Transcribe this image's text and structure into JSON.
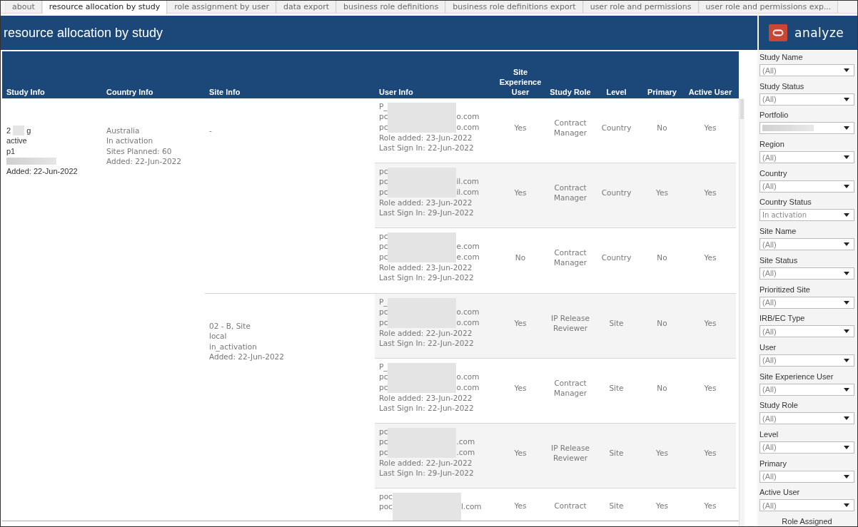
{
  "tabs": [
    {
      "label": "about",
      "selected": false
    },
    {
      "label": "resource allocation by study",
      "selected": true
    },
    {
      "label": "role assignment by user",
      "selected": false
    },
    {
      "label": "data export",
      "selected": false
    },
    {
      "label": "business role definitions",
      "selected": false
    },
    {
      "label": "business role definitions export",
      "selected": false
    },
    {
      "label": "user role and permissions",
      "selected": false
    },
    {
      "label": "user role and permissions exp...",
      "selected": false
    }
  ],
  "dashboard": {
    "title": "resource allocation by study",
    "logo_text": "analyze"
  },
  "table": {
    "columns": [
      "Study Info",
      "Country Info",
      "Site Info",
      "User Info",
      "Site Experience User",
      "Study Role",
      "Level",
      "Primary",
      "Active User"
    ],
    "study_info": [
      {
        "text": "2",
        "tail": "g",
        "redacted": true
      },
      {
        "text": "active",
        "redacted": false
      },
      {
        "text": "p1",
        "redacted": false
      },
      {
        "redacted": true
      },
      {
        "text": "Added: 22-Jun-2022",
        "redacted": false
      }
    ],
    "country_info": [
      "Australia",
      "In activation",
      "Sites Planned: 60",
      "Added: 22-Jun-2022"
    ],
    "sites": [
      {
        "info": [
          "-"
        ],
        "users": [
          {
            "name": "P_",
            "emails": [
              [
                "pc",
                "o.com"
              ],
              [
                "pc",
                "o.com"
              ]
            ],
            "details": [
              "Role added: 23-Jun-2022",
              "Last Sign In: 22-Jun-2022"
            ],
            "site_experience": "Yes",
            "role": "Contract Manager",
            "level": "Country",
            "primary": "No",
            "active": "Yes"
          },
          {
            "name": "pc",
            "emails": [
              [
                "pc",
                "il.com"
              ],
              [
                "pc",
                "il.com"
              ]
            ],
            "details": [
              "Role added: 23-Jun-2022",
              "Last Sign In: 29-Jun-2022"
            ],
            "site_experience": "Yes",
            "role": "Contract Manager",
            "level": "Country",
            "primary": "Yes",
            "active": "Yes"
          },
          {
            "name": "pc",
            "emails": [
              [
                "pc",
                "e.com"
              ],
              [
                "pc",
                "e.com"
              ]
            ],
            "details": [
              "Role added: 23-Jun-2022",
              "Last Sign In: 29-Jun-2022"
            ],
            "site_experience": "No",
            "role": "Contract Manager",
            "level": "Country",
            "primary": "No",
            "active": "Yes"
          }
        ]
      },
      {
        "info": [
          "02 - B, Site",
          "local",
          "in_activation",
          "Added: 22-Jun-2022"
        ],
        "users": [
          {
            "name": "P_",
            "emails": [
              [
                "pc",
                "o.com"
              ],
              [
                "pc",
                "o.com"
              ]
            ],
            "details": [
              "Role added: 22-Jun-2022",
              "Last Sign In: 22-Jun-2022"
            ],
            "site_experience": "Yes",
            "role": "IP Release Reviewer",
            "level": "Site",
            "primary": "No",
            "active": "Yes"
          },
          {
            "name": "P_",
            "emails": [
              [
                "pc",
                "o.com"
              ],
              [
                "pc",
                "o.com"
              ]
            ],
            "details": [
              "Role added: 23-Jun-2022",
              "Last Sign In: 22-Jun-2022"
            ],
            "site_experience": "Yes",
            "role": "Contract Manager",
            "level": "Site",
            "primary": "No",
            "active": "Yes"
          },
          {
            "name": "pc",
            "emails": [
              [
                "pc",
                ".com"
              ],
              [
                "pc",
                ".com"
              ]
            ],
            "details": [
              "Role added: 22-Jun-2022",
              "Last Sign In: 29-Jun-2022"
            ],
            "site_experience": "Yes",
            "role": "IP Release Reviewer",
            "level": "Site",
            "primary": "Yes",
            "active": "Yes"
          },
          {
            "name": "poc",
            "emails": [
              [
                "poc",
                "l.com"
              ]
            ],
            "site_experience": "Yes",
            "role": "Contract",
            "level": "Site",
            "primary": "Yes",
            "active": "Yes"
          }
        ]
      }
    ]
  },
  "filters": [
    {
      "label": "Study Name",
      "value": "(All)",
      "redacted": false
    },
    {
      "label": "Study Status",
      "value": "(All)",
      "redacted": false
    },
    {
      "label": "Portfolio",
      "redacted": true
    },
    {
      "label": "Region",
      "value": "(All)",
      "redacted": false
    },
    {
      "label": "Country",
      "value": "(All)",
      "redacted": false
    },
    {
      "label": "Country Status",
      "value": "In activation",
      "redacted": false
    },
    {
      "label": "Site Name",
      "value": "(All)",
      "redacted": false
    },
    {
      "label": "Site Status",
      "value": "(All)",
      "redacted": false
    },
    {
      "label": "Prioritized Site",
      "value": "(All)",
      "redacted": false
    },
    {
      "label": "IRB/EC Type",
      "value": "(All)",
      "redacted": false
    },
    {
      "label": "User",
      "value": "(All)",
      "redacted": false
    },
    {
      "label": "Site Experience User",
      "value": "(All)",
      "redacted": false
    },
    {
      "label": "Study Role",
      "value": "(All)",
      "redacted": false
    },
    {
      "label": "Level",
      "value": "(All)",
      "redacted": false
    },
    {
      "label": "Primary",
      "value": "(All)",
      "redacted": false
    },
    {
      "label": "Active User",
      "value": "(All)",
      "redacted": false
    }
  ],
  "legend_title": "Role Assigned"
}
